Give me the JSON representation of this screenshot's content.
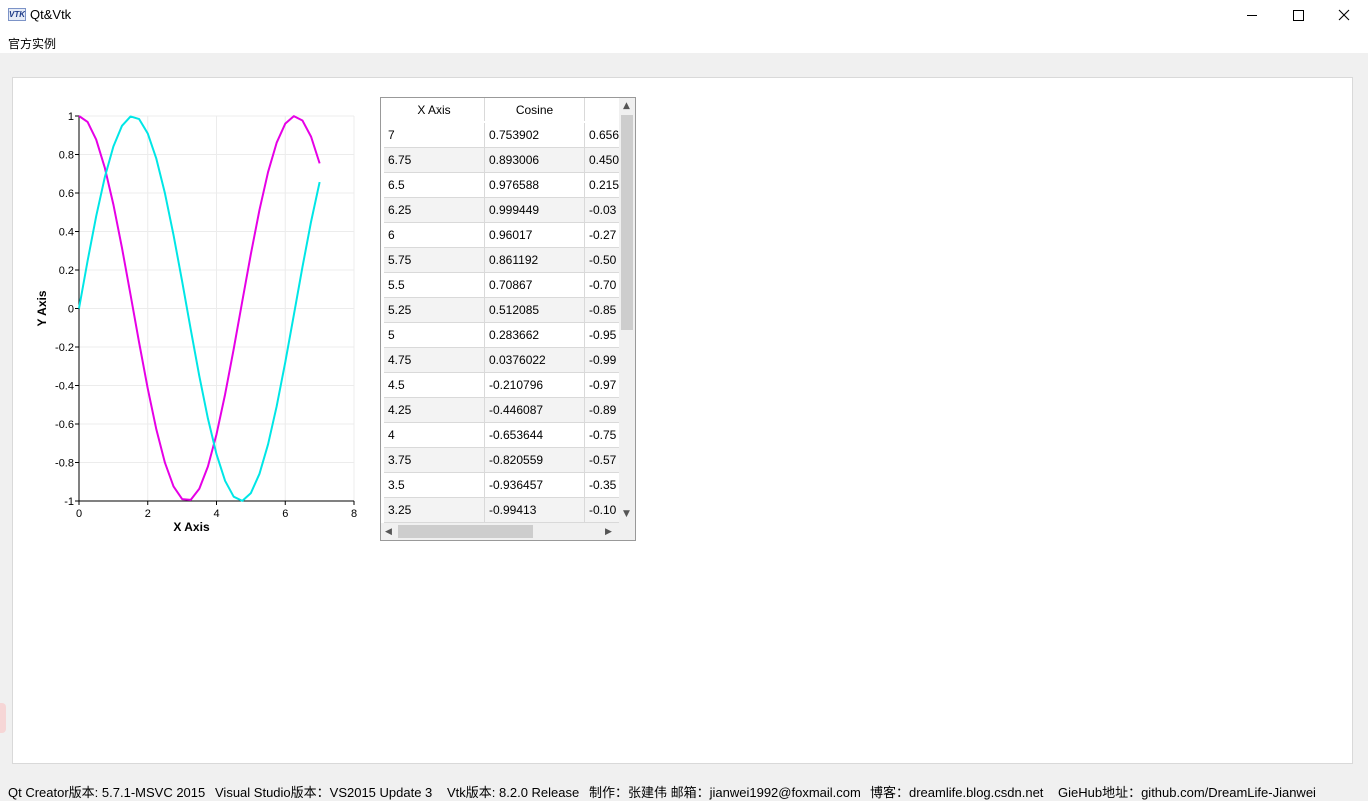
{
  "window": {
    "title": "Qt&Vtk",
    "icon": "vtk-logo-icon"
  },
  "menu": {
    "items": [
      "官方实例"
    ]
  },
  "colors": {
    "cosine": "#e600e6",
    "sine": "#00e6e6",
    "grid": "#ececec"
  },
  "chart_data": {
    "type": "line",
    "xlabel": "X Axis",
    "ylabel": "Y Axis",
    "xlim": [
      0,
      8
    ],
    "ylim": [
      -1,
      1
    ],
    "xticks": [
      "0",
      "2",
      "4",
      "6",
      "8"
    ],
    "yticks": [
      "1",
      "0.8",
      "0.6",
      "0.4",
      "0.2",
      "0",
      "-0.2",
      "-0.4",
      "-0.6",
      "-0.8",
      "-1"
    ],
    "grid": true,
    "series": [
      {
        "color": "#e600e6",
        "x": [
          0,
          0.25,
          0.5,
          0.75,
          1,
          1.25,
          1.5,
          1.75,
          2,
          2.25,
          2.5,
          2.75,
          3,
          3.25,
          3.5,
          3.75,
          4,
          4.25,
          4.5,
          4.75,
          5,
          5.25,
          5.5,
          5.75,
          6,
          6.25,
          6.5,
          6.75,
          7
        ],
        "y": [
          1,
          0.968912,
          0.877583,
          0.731689,
          0.540302,
          0.315322,
          0.0707372,
          -0.178246,
          -0.416147,
          -0.628174,
          -0.801144,
          -0.924302,
          -0.989992,
          -0.99413,
          -0.936457,
          -0.820559,
          -0.653644,
          -0.446087,
          -0.210796,
          0.0376022,
          0.283662,
          0.512085,
          0.70867,
          0.861192,
          0.96017,
          0.999449,
          0.976588,
          0.893006,
          0.753902
        ]
      },
      {
        "color": "#00e6e6",
        "x": [
          0,
          0.25,
          0.5,
          0.75,
          1,
          1.25,
          1.5,
          1.75,
          2,
          2.25,
          2.5,
          2.75,
          3,
          3.25,
          3.5,
          3.75,
          4,
          4.25,
          4.5,
          4.75,
          5,
          5.25,
          5.5,
          5.75,
          6,
          6.25,
          6.5,
          6.75,
          7
        ],
        "y": [
          0,
          0.247404,
          0.479426,
          0.681639,
          0.841471,
          0.948985,
          0.997495,
          0.983986,
          0.909297,
          0.778073,
          0.598472,
          0.381661,
          0.14112,
          -0.108195,
          -0.350783,
          -0.571561,
          -0.756802,
          -0.894989,
          -0.97753,
          -0.999293,
          -0.958924,
          -0.858934,
          -0.70554,
          -0.508279,
          -0.279415,
          -0.0331792,
          0.21512,
          0.450044,
          0.656987
        ]
      }
    ]
  },
  "table": {
    "headers": [
      "X Axis",
      "Cosine",
      ""
    ],
    "rows": [
      [
        "7",
        "0.753902",
        "0.656"
      ],
      [
        "6.75",
        "0.893006",
        "0.450"
      ],
      [
        "6.5",
        "0.976588",
        "0.215"
      ],
      [
        "6.25",
        "0.999449",
        "-0.03"
      ],
      [
        "6",
        "0.96017",
        "-0.27"
      ],
      [
        "5.75",
        "0.861192",
        "-0.50"
      ],
      [
        "5.5",
        "0.70867",
        "-0.70"
      ],
      [
        "5.25",
        "0.512085",
        "-0.85"
      ],
      [
        "5",
        "0.283662",
        "-0.95"
      ],
      [
        "4.75",
        "0.0376022",
        "-0.99"
      ],
      [
        "4.5",
        "-0.210796",
        "-0.97"
      ],
      [
        "4.25",
        "-0.446087",
        "-0.89"
      ],
      [
        "4",
        "-0.653644",
        "-0.75"
      ],
      [
        "3.75",
        "-0.820559",
        "-0.57"
      ],
      [
        "3.5",
        "-0.936457",
        "-0.35"
      ],
      [
        "3.25",
        "-0.99413",
        "-0.10"
      ]
    ]
  },
  "status": {
    "items": [
      "Qt Creator版本: 5.7.1-MSVC 2015",
      "Visual Studio版本：VS2015 Update 3",
      "Vtk版本: 8.2.0 Release",
      "制作：张建伟  邮箱：jianwei1992@foxmail.com",
      "博客：dreamlife.blog.csdn.net",
      "GieHub地址：github.com/DreamLife-Jianwei"
    ]
  }
}
